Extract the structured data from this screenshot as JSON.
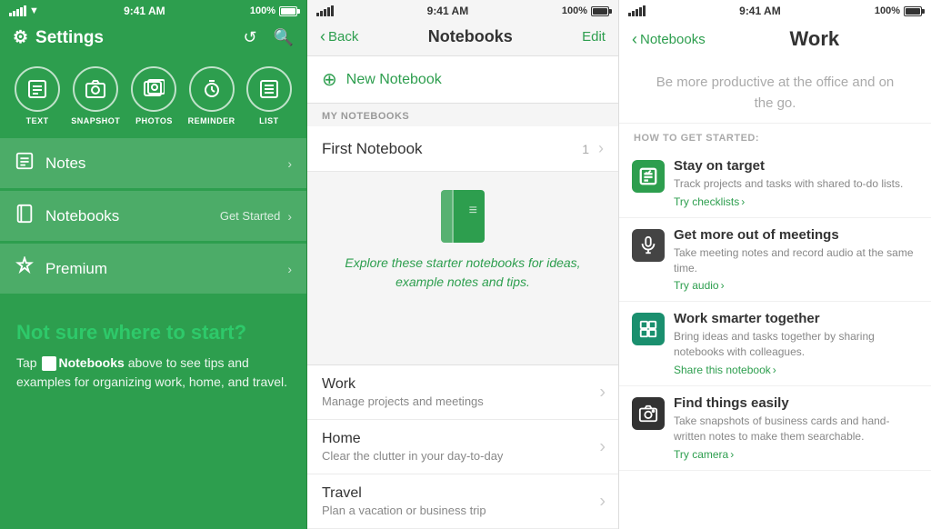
{
  "panel1": {
    "status": {
      "time": "9:41 AM",
      "battery": "100%"
    },
    "header": {
      "title": "Settings",
      "gear_icon": "⚙",
      "refresh_icon": "↺",
      "search_icon": "🔍"
    },
    "type_icons": [
      {
        "label": "TEXT",
        "icon": "☰"
      },
      {
        "label": "SNAPSHOT",
        "icon": "📷"
      },
      {
        "label": "PHOTOS",
        "icon": "🖼"
      },
      {
        "label": "REMINDER",
        "icon": "⏰"
      },
      {
        "label": "LIST",
        "icon": "☰"
      }
    ],
    "menu_items": [
      {
        "label": "Notes",
        "icon": "☰",
        "badge": "",
        "has_chevron": true
      },
      {
        "label": "Notebooks",
        "icon": "📓",
        "badge": "Get Started",
        "has_chevron": true
      },
      {
        "label": "Premium",
        "icon": "🛡",
        "badge": "",
        "has_chevron": true
      }
    ],
    "bottom": {
      "headline": "Not sure where to start?",
      "body": "Tap  Notebooks above to see tips and examples for organizing work, home, and travel.",
      "notebooks_word": "Notebooks"
    }
  },
  "panel2": {
    "status": {
      "time": "9:41 AM",
      "battery": "100%"
    },
    "header": {
      "back_label": "Back",
      "title": "Notebooks",
      "edit_label": "Edit"
    },
    "new_notebook": {
      "label": "New Notebook"
    },
    "section_header": "MY NOTEBOOKS",
    "notebooks": [
      {
        "name": "First Notebook",
        "count": "1"
      }
    ],
    "starter_text": "Explore these starter notebooks for ideas, example notes and tips.",
    "starter_items": [
      {
        "title": "Work",
        "desc": "Manage projects and meetings"
      },
      {
        "title": "Home",
        "desc": "Clear the clutter in your day-to-day"
      },
      {
        "title": "Travel",
        "desc": "Plan a vacation or business trip"
      }
    ]
  },
  "panel3": {
    "status": {
      "time": "9:41 AM",
      "battery": "100%"
    },
    "header": {
      "back_label": "Notebooks",
      "title": "Work"
    },
    "intro": "Be more productive at the office and on the go.",
    "how_to_header": "HOW TO GET STARTED:",
    "tips": [
      {
        "icon": "checklist",
        "icon_char": "☑",
        "icon_class": "green",
        "title": "Stay on target",
        "desc": "Track projects and tasks with shared to-do lists.",
        "link": "Try checklists"
      },
      {
        "icon": "microphone",
        "icon_char": "🎤",
        "icon_class": "dark",
        "title": "Get more out of meetings",
        "desc": "Take meeting notes and record audio at the same time.",
        "link": "Try audio"
      },
      {
        "icon": "share",
        "icon_char": "⊞",
        "icon_class": "teal",
        "title": "Work smarter together",
        "desc": "Bring ideas and tasks together by sharing notebooks with colleagues.",
        "link": "Share this notebook"
      },
      {
        "icon": "camera",
        "icon_char": "📷",
        "icon_class": "camera",
        "title": "Find things easily",
        "desc": "Take snapshots of business cards and hand-written notes to make them searchable.",
        "link": "Try camera"
      }
    ]
  }
}
